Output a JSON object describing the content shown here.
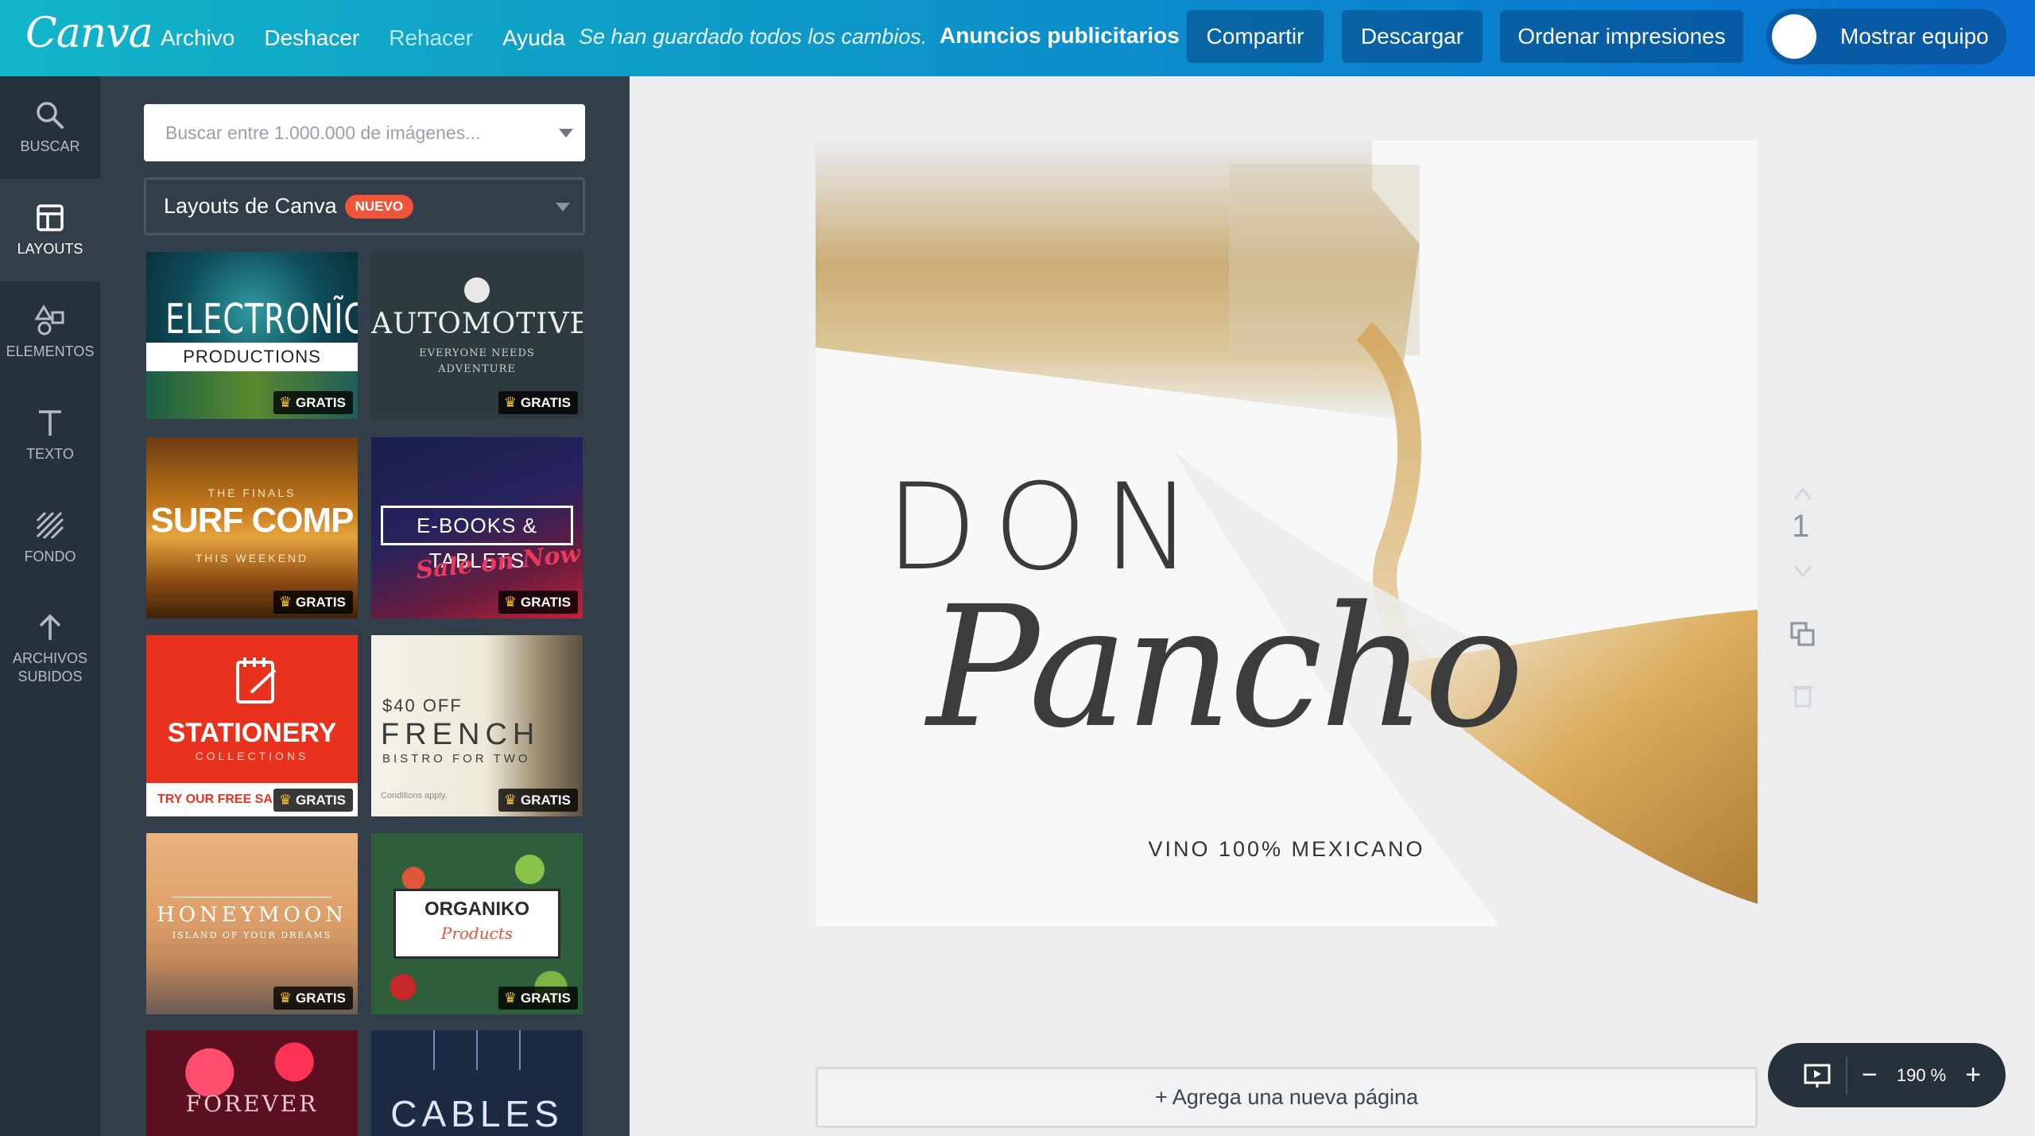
{
  "topbar": {
    "logo": "Canva",
    "menu": [
      "Archivo",
      "Deshacer",
      "Rehacer",
      "Ayuda"
    ],
    "saved_status": "Se han guardado todos los cambios.",
    "design_type": "Anuncios publicitarios",
    "share": "Compartir",
    "download": "Descargar",
    "order_prints": "Ordenar impresiones",
    "show_team": "Mostrar equipo"
  },
  "rail": {
    "search": "BUSCAR",
    "layouts": "LAYOUTS",
    "elements": "ELEMENTOS",
    "text": "TEXTO",
    "background": "FONDO",
    "uploads_1": "ARCHIVOS",
    "uploads_2": "SUBIDOS"
  },
  "panel": {
    "search_placeholder": "Buscar entre 1.000.000 de imágenes...",
    "layout_select": "Layouts de Canva",
    "new_badge": "NUEVO",
    "gratis": "GRATIS",
    "thumbs": {
      "electronica_title": "ELECTRONĨCA",
      "electronica_sub": "PRODUCTIONS",
      "automotive_title": "AUTOMOTIVE",
      "automotive_sub1": "EVERYONE NEEDS",
      "automotive_sub2": "ADVENTURE",
      "surf_top": "THE FINALS",
      "surf_title": "SURF COMP",
      "surf_sub": "THIS WEEKEND",
      "ebooks_title": "E-BOOKS & TABLETS",
      "ebooks_script": "Sale on Now",
      "stationery_title": "STATIONERY",
      "stationery_sub": "COLLECTIONS",
      "stationery_cta": "TRY OUR FREE SA",
      "french_off": "$40 OFF",
      "french_title": "FRENCH",
      "french_sub": "BISTRO FOR TWO",
      "french_cond": "Conditions apply.",
      "honeymoon_title": "HONEYMOON",
      "honeymoon_sub": "ISLAND OF YOUR DREAMS",
      "organiko_title": "ORGANIKO",
      "organiko_sub": "Products",
      "forever_title": "FOREVER",
      "cables_title": "CABLES"
    }
  },
  "design": {
    "line1": "DON",
    "line2": "Pancho",
    "tagline": "VINO 100% MEXICANO"
  },
  "page_number": "1",
  "add_page": "+ Agrega una nueva página",
  "zoom": {
    "level": "190 %",
    "minus": "−",
    "plus": "+"
  }
}
